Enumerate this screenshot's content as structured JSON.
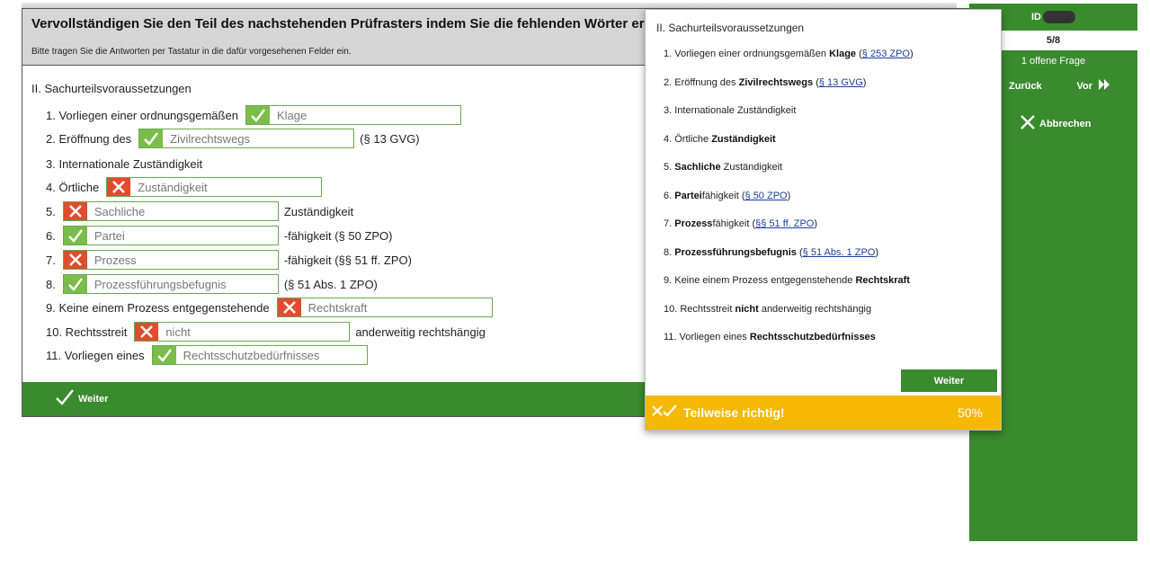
{
  "quiz": {
    "title": "Vervollständigen Sie den Teil des nachstehenden Prüfrasters indem Sie die fehlenden Wörter ergänzen.",
    "instruction": "Bitte tragen Sie die Antworten per Tastatur in die dafür vorgesehenen Felder ein.",
    "heading": "II. Sachurteilsvoraussetzungen",
    "rows": [
      {
        "pre": "1. Vorliegen einer ordnungsgemäßen",
        "value": "Klage",
        "correct": true,
        "post": ""
      },
      {
        "pre": "2. Eröffnung des",
        "value": "Zivilrechtswegs",
        "correct": true,
        "post": "(§ 13 GVG)"
      },
      {
        "pre": "3. Internationale Zuständigkeit"
      },
      {
        "pre": "4. Örtliche",
        "value": "Zuständigkeit",
        "correct": false,
        "post": ""
      },
      {
        "pre": "5.",
        "value": "Sachliche",
        "correct": false,
        "post": "Zuständigkeit"
      },
      {
        "pre": "6.",
        "value": "Partei",
        "correct": true,
        "post": "-fähigkeit (§ 50 ZPO)"
      },
      {
        "pre": "7.",
        "value": "Prozess",
        "correct": false,
        "post": "-fähigkeit (§§ 51 ff. ZPO)"
      },
      {
        "pre": "8.",
        "value": "Prozessführungsbefugnis",
        "correct": true,
        "post": "(§ 51 Abs. 1 ZPO)"
      },
      {
        "pre": "9. Keine einem Prozess entgegenstehende",
        "value": "Rechtskraft",
        "correct": false,
        "post": ""
      },
      {
        "pre": "10. Rechtsstreit",
        "value": "nicht",
        "correct": false,
        "post": "anderweitig rechtshängig"
      },
      {
        "pre": "11. Vorliegen eines",
        "value": "Rechtsschutzbedürfnisses",
        "correct": true,
        "post": ""
      }
    ],
    "footer_button": "Weiter"
  },
  "sidebar": {
    "id_label": "ID",
    "progress": "5/8",
    "open_questions": "1 offene Frage",
    "back": "Zurück",
    "next": "Vor",
    "cancel": "Abbrechen"
  },
  "popup": {
    "heading": "II. Sachurteilsvoraussetzungen",
    "items": [
      [
        {
          "t": "1. Vorliegen einer ordnungsgemäßen "
        },
        {
          "t": "Klage",
          "b": true
        },
        {
          "t": " ("
        },
        {
          "t": "§ 253 ZPO",
          "link": true
        },
        {
          "t": ")"
        }
      ],
      [
        {
          "t": "2. Eröffnung des "
        },
        {
          "t": "Zivilrechtswegs",
          "b": true
        },
        {
          "t": " ("
        },
        {
          "t": "§ 13 GVG",
          "link": true
        },
        {
          "t": ")"
        }
      ],
      [
        {
          "t": "3. Internationale Zuständigkeit"
        }
      ],
      [
        {
          "t": "4. Örtliche "
        },
        {
          "t": "Zuständigkeit",
          "b": true
        }
      ],
      [
        {
          "t": "5. "
        },
        {
          "t": "Sachliche",
          "b": true
        },
        {
          "t": " Zuständigkeit"
        }
      ],
      [
        {
          "t": "6. "
        },
        {
          "t": "Partei",
          "b": true
        },
        {
          "t": "fähigkeit ("
        },
        {
          "t": "§ 50 ZPO",
          "link": true
        },
        {
          "t": ")"
        }
      ],
      [
        {
          "t": "7. "
        },
        {
          "t": "Prozess",
          "b": true
        },
        {
          "t": "fähigkeit ("
        },
        {
          "t": "§§ 51 ff. ZPO",
          "link": true
        },
        {
          "t": ")"
        }
      ],
      [
        {
          "t": "8. "
        },
        {
          "t": "Prozessführungsbefugnis",
          "b": true
        },
        {
          "t": " ("
        },
        {
          "t": "§ 51 Abs. 1 ZPO",
          "link": true
        },
        {
          "t": ")"
        }
      ],
      [
        {
          "t": "9. Keine einem Prozess entgegenstehende "
        },
        {
          "t": "Rechtskraft",
          "b": true
        }
      ],
      [
        {
          "t": "10. Rechtsstreit "
        },
        {
          "t": "nicht",
          "b": true
        },
        {
          "t": " anderweitig rechtshängig"
        }
      ],
      [
        {
          "t": "11. Vorliegen eines "
        },
        {
          "t": "Rechtsschutzbedürfnisses",
          "b": true
        }
      ]
    ],
    "button": "Weiter",
    "result_text": "Teilweise richtig!",
    "result_percent": "50%"
  },
  "colors": {
    "brand_green": "#3a8a2e",
    "correct_green": "#7bbd4a",
    "wrong_red": "#e14b2e",
    "partial_yellow": "#f5b800",
    "link_blue": "#1a3fa0"
  },
  "icons": {
    "correct": "check-icon",
    "wrong": "cross-icon",
    "next": "double-chevron-right-icon",
    "cancel": "close-icon",
    "partial": "check-cross-icon"
  }
}
